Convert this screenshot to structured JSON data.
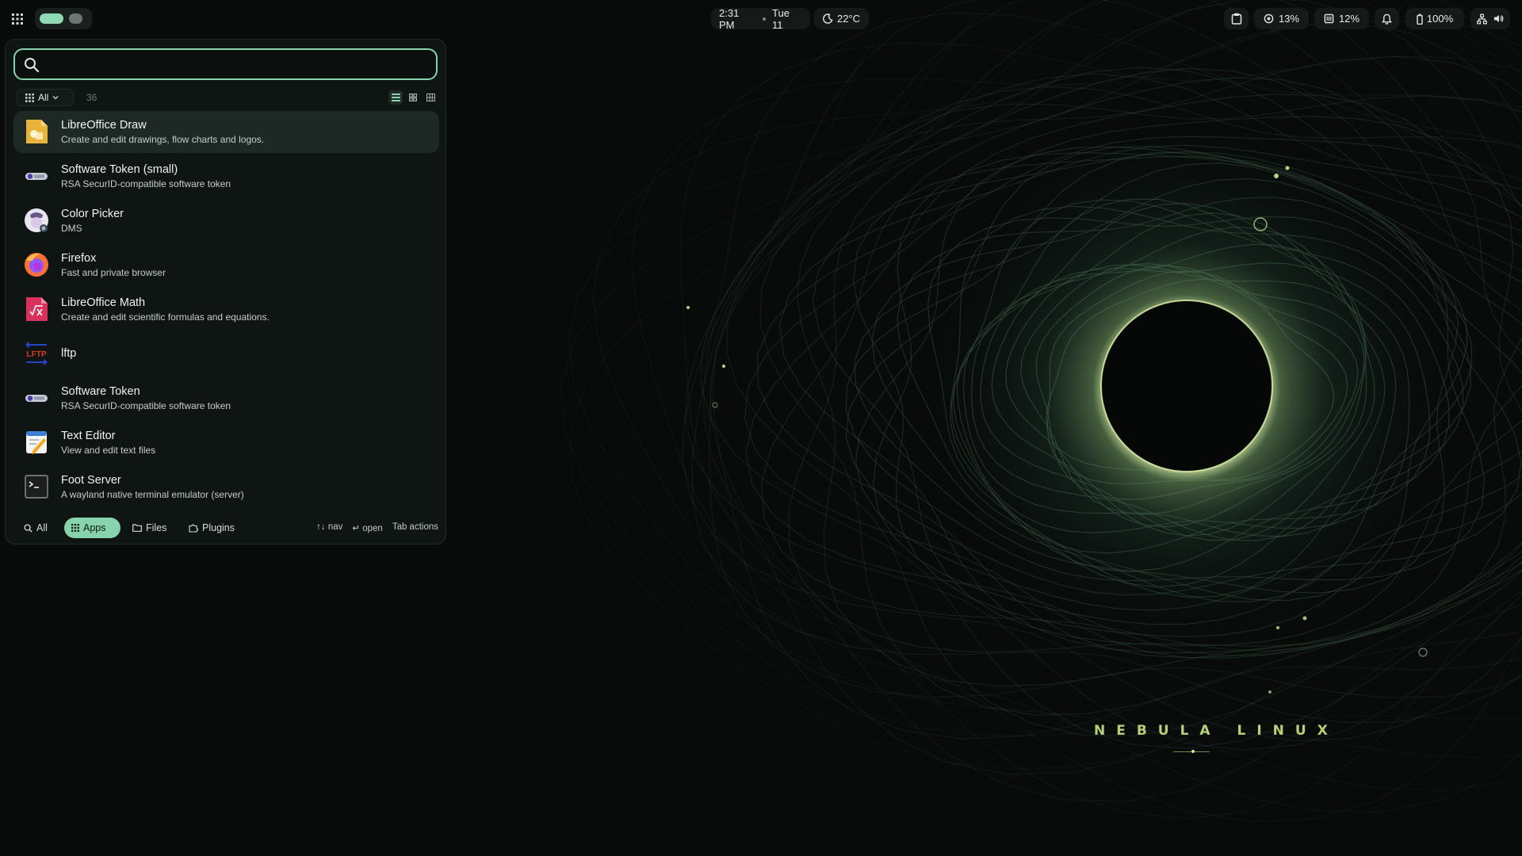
{
  "wallpaper": {
    "title": "NEBULA LINUX"
  },
  "topbar": {
    "launcher_icon": "grid-icon",
    "clock": {
      "time": "2:31 PM",
      "date": "Tue 11"
    },
    "weather": {
      "icon": "moon-icon",
      "temp": "22°C"
    },
    "clipboard_icon": "clipboard-icon",
    "cpu": {
      "icon": "cpu-icon",
      "value": "13%"
    },
    "memory": {
      "icon": "memory-icon",
      "value": "12%"
    },
    "notifications_icon": "bell-icon",
    "battery": {
      "icon": "battery-icon",
      "value": "100%"
    },
    "network_icon": "network-icon",
    "volume_icon": "volume-icon"
  },
  "launcher": {
    "search": {
      "placeholder": "",
      "value": ""
    },
    "category": {
      "selected": "All"
    },
    "count": "36",
    "apps": [
      {
        "name": "LibreOffice Draw",
        "desc": "Create and edit drawings, flow charts and logos.",
        "icon": "libreoffice-draw-icon"
      },
      {
        "name": "Software Token (small)",
        "desc": "RSA SecurID-compatible software token",
        "icon": "token-icon"
      },
      {
        "name": "Color Picker",
        "desc": "DMS",
        "icon": "color-picker-icon"
      },
      {
        "name": "Firefox",
        "desc": "Fast and private browser",
        "icon": "firefox-icon"
      },
      {
        "name": "LibreOffice Math",
        "desc": "Create and edit scientific formulas and equations.",
        "icon": "libreoffice-math-icon"
      },
      {
        "name": "lftp",
        "desc": "",
        "icon": "lftp-icon"
      },
      {
        "name": "Software Token",
        "desc": "RSA SecurID-compatible software token",
        "icon": "token-icon"
      },
      {
        "name": "Text Editor",
        "desc": "View and edit text files",
        "icon": "text-editor-icon"
      },
      {
        "name": "Foot Server",
        "desc": "A wayland native terminal emulator (server)",
        "icon": "terminal-icon"
      }
    ],
    "modes": {
      "all": "All",
      "apps": "Apps",
      "files": "Files",
      "plugins": "Plugins"
    },
    "hints": {
      "nav": "↑↓ nav",
      "open": "↵ open",
      "tab": "Tab actions"
    }
  },
  "colors": {
    "accent": "#86d3ad",
    "panel": "#0f1513",
    "selected": "#1e2925"
  }
}
